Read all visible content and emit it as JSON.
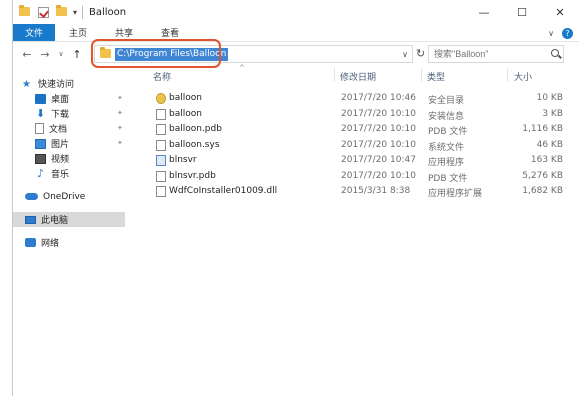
{
  "window": {
    "title": "Balloon",
    "qa_dropdown": "▾",
    "controls": {
      "minimize": "—",
      "maximize": "☐",
      "close": "✕"
    }
  },
  "ribbon": {
    "tabs": [
      {
        "label": "文件"
      },
      {
        "label": "主页"
      },
      {
        "label": "共享"
      },
      {
        "label": "查看"
      }
    ],
    "expand_chevron": "∨",
    "help": "?"
  },
  "nav": {
    "back": "←",
    "forward": "→",
    "recent": "∨",
    "up": "↑",
    "address": "C:\\Program Files\\Balloon",
    "address_dropdown": "∨",
    "refresh": "↻",
    "search_placeholder": "搜索\"Balloon\""
  },
  "sidebar": {
    "quick_access": "快速访问",
    "items": [
      {
        "label": "桌面",
        "icon": "desktop-icon",
        "pinned": true
      },
      {
        "label": "下载",
        "icon": "download-icon",
        "pinned": true
      },
      {
        "label": "文档",
        "icon": "document-icon",
        "pinned": true
      },
      {
        "label": "图片",
        "icon": "picture-icon",
        "pinned": true
      },
      {
        "label": "视频",
        "icon": "video-icon",
        "pinned": false
      },
      {
        "label": "音乐",
        "icon": "music-icon",
        "pinned": false
      }
    ],
    "onedrive": "OneDrive",
    "this_pc": "此电脑",
    "network": "网络",
    "pin_glyph": "📌"
  },
  "columns": {
    "name": "名称",
    "date": "修改日期",
    "type": "类型",
    "size": "大小",
    "sort_indicator": "^"
  },
  "files": [
    {
      "name": "balloon",
      "date": "2017/7/20 10:46",
      "type": "安全目录",
      "size": "10 KB",
      "icon": "catalog-icon"
    },
    {
      "name": "balloon",
      "date": "2017/7/20 10:10",
      "type": "安装信息",
      "size": "3 KB",
      "icon": "setup-info-icon"
    },
    {
      "name": "balloon.pdb",
      "date": "2017/7/20 10:10",
      "type": "PDB 文件",
      "size": "1,116 KB",
      "icon": "file-icon"
    },
    {
      "name": "balloon.sys",
      "date": "2017/7/20 10:10",
      "type": "系统文件",
      "size": "46 KB",
      "icon": "system-file-icon"
    },
    {
      "name": "blnsvr",
      "date": "2017/7/20 10:47",
      "type": "应用程序",
      "size": "163 KB",
      "icon": "application-icon"
    },
    {
      "name": "blnsvr.pdb",
      "date": "2017/7/20 10:10",
      "type": "PDB 文件",
      "size": "5,276 KB",
      "icon": "file-icon"
    },
    {
      "name": "WdfCoInstaller01009.dll",
      "date": "2015/3/31 8:38",
      "type": "应用程序扩展",
      "size": "1,682 KB",
      "icon": "dll-icon"
    }
  ]
}
